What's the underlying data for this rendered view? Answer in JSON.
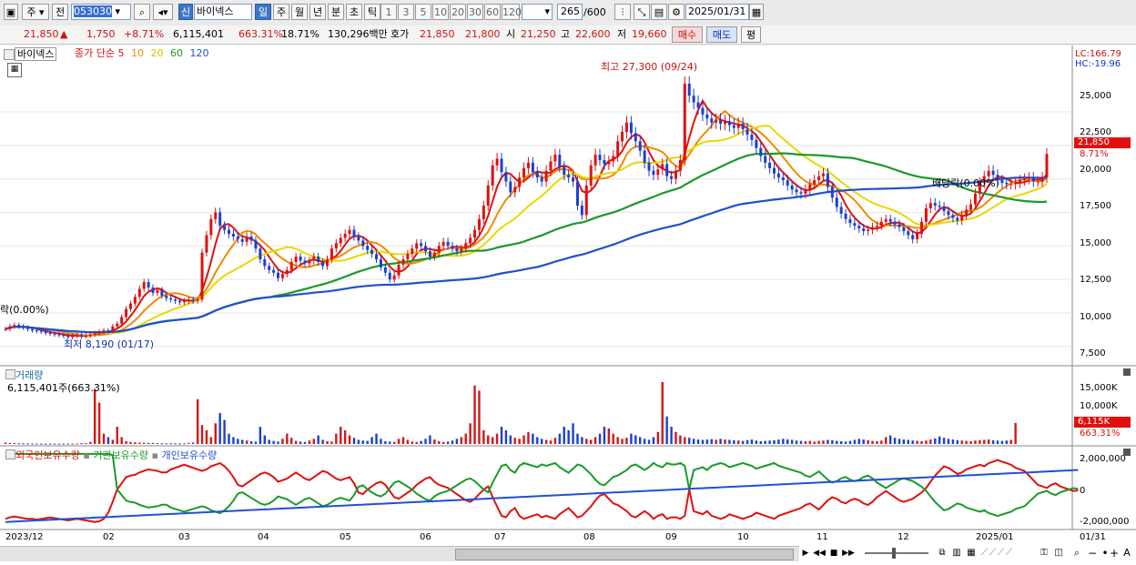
{
  "toolbar": {
    "type_label": "주",
    "prev_label": "전",
    "code": "053030",
    "stock_name": "바이넥스",
    "stock_tag": "신",
    "period_tabs": [
      "일",
      "주",
      "월",
      "년",
      "분",
      "초",
      "틱"
    ],
    "interval_buttons": [
      "1",
      "3",
      "5",
      "10",
      "20",
      "30",
      "60",
      "120"
    ],
    "count_current": "265",
    "count_total": "/600",
    "date": "2025/01/31"
  },
  "quote": {
    "price": "21,850",
    "change": "1,750",
    "change_pct": "+8.71%",
    "volume": "6,115,401",
    "volume_ratio": "663.31%",
    "turnover": "18.71%",
    "amount": "130,296백만",
    "bid_label": "호가",
    "ask_price": "21,850",
    "bid_price": "21,800",
    "open_label": "시",
    "open": "21,250",
    "high_label": "고",
    "high": "22,600",
    "low_label": "저",
    "low": "19,660",
    "buy_button": "매수",
    "sell_button": "매도",
    "eval_button": "평"
  },
  "price_panel": {
    "name_tag": "바이넥스",
    "ma_label": "종가 단순",
    "ma_periods": [
      "5",
      "10",
      "20",
      "60",
      "120"
    ],
    "ma_colors": [
      "#e01010",
      "#f08a00",
      "#e8d800",
      "#1a9a2a",
      "#2050d0"
    ],
    "lc": "LC:166.79",
    "hc": "HC:-19.96",
    "high_annotation": "최고 27,300 (09/24)",
    "low_annotation": "최저 8,190 (01/17)",
    "left_annotation": "락(0.00%)",
    "dividend_annotation": "배당락(0.00%)",
    "current_price_tag": "21,850",
    "current_pct_tag": "8.71%",
    "y_ticks": [
      "25,000",
      "22,500",
      "20,000",
      "17,500",
      "15,000",
      "12,500",
      "10,000",
      "7,500"
    ]
  },
  "volume_panel": {
    "title": "거래량",
    "value_label": "6,115,401주(663.31%)",
    "y_ticks": [
      "15,000K",
      "10,000K"
    ],
    "current_tag": "6,115K",
    "current_pct": "663.31%"
  },
  "holdings_panel": {
    "legend": [
      "외국인보유수량",
      "기관보유수량",
      "개인보유수량"
    ],
    "legend_colors": [
      "#e01010",
      "#1a9a2a",
      "#2050d0"
    ],
    "y_ticks": [
      "2,000,000",
      "0",
      "-2,000,000"
    ]
  },
  "x_axis": [
    "2023/12",
    "02",
    "03",
    "04",
    "05",
    "06",
    "07",
    "08",
    "09",
    "10",
    "11",
    "12",
    "2025/01",
    "01/31"
  ],
  "chart_data": {
    "type": "line",
    "ylim": [
      6200,
      29400
    ],
    "y_ticks": [
      25000,
      22500,
      20000,
      17500,
      15000,
      12500,
      10000,
      7500
    ],
    "close": [
      8800,
      9000,
      9100,
      9000,
      8900,
      8800,
      8700,
      8650,
      8600,
      8500,
      8450,
      8400,
      8350,
      8300,
      8200,
      8300,
      8350,
      8250,
      8300,
      8400,
      8500,
      8600,
      8700,
      8650,
      9000,
      9200,
      9700,
      10300,
      10700,
      11200,
      11800,
      12300,
      11900,
      11500,
      11700,
      11300,
      11100,
      11000,
      10900,
      10800,
      10900,
      11000,
      10900,
      11000,
      14500,
      15800,
      17000,
      17500,
      16500,
      16200,
      15900,
      15700,
      15500,
      15300,
      15700,
      15400,
      14800,
      14000,
      13500,
      13200,
      13000,
      12600,
      12900,
      13200,
      13800,
      14200,
      13900,
      13700,
      13900,
      14200,
      13800,
      13500,
      14000,
      14800,
      15200,
      15600,
      15900,
      16200,
      15700,
      15400,
      15000,
      14700,
      14400,
      14000,
      13400,
      13000,
      12500,
      12800,
      13600,
      14000,
      14400,
      14800,
      15200,
      15000,
      14600,
      14200,
      14500,
      15000,
      15300,
      15000,
      14800,
      14600,
      14800,
      15200,
      15600,
      16200,
      17000,
      18000,
      19500,
      21000,
      21500,
      20500,
      19800,
      19000,
      19400,
      20100,
      20800,
      21200,
      20500,
      20100,
      19800,
      20600,
      21300,
      21800,
      20900,
      20300,
      20100,
      19800,
      18000,
      17300,
      19500,
      21000,
      21800,
      21400,
      21100,
      21300,
      21700,
      22800,
      23500,
      24200,
      23400,
      22800,
      22100,
      21200,
      20600,
      20300,
      20700,
      21100,
      20200,
      20000,
      20600,
      21400,
      27100,
      26200,
      25700,
      25300,
      24800,
      24500,
      24200,
      24400,
      24100,
      24300,
      24000,
      23800,
      24100,
      23700,
      23300,
      22900,
      22300,
      21700,
      21200,
      20800,
      20400,
      20100,
      19900,
      19500,
      19200,
      19000,
      18900,
      19200,
      19600,
      19900,
      20200,
      20400,
      19400,
      18600,
      17900,
      17400,
      17000,
      16700,
      16500,
      16300,
      16100,
      16200,
      16400,
      16500,
      16800,
      17000,
      16800,
      16600,
      16400,
      16100,
      15800,
      15500,
      15900,
      16800,
      17800,
      18200,
      18000,
      17900,
      17600,
      17300,
      17100,
      16900,
      17300,
      17700,
      18100,
      18900,
      19700,
      20200,
      20600,
      20300,
      19900,
      19700,
      19600,
      19600,
      19700,
      19900,
      20000,
      20100,
      19800,
      19800,
      20100,
      21850
    ],
    "volume_k": [
      400,
      300,
      250,
      200,
      180,
      150,
      120,
      100,
      100,
      80,
      90,
      110,
      100,
      90,
      120,
      100,
      150,
      200,
      250,
      600,
      16000,
      12000,
      3000,
      2000,
      1200,
      5000,
      2000,
      800,
      600,
      500,
      400,
      350,
      300,
      300,
      250,
      200,
      200,
      200,
      150,
      150,
      200,
      300,
      400,
      13000,
      5500,
      4000,
      2000,
      6000,
      9000,
      7000,
      3000,
      2000,
      1500,
      1200,
      1000,
      800,
      700,
      5000,
      2500,
      1200,
      900,
      700,
      1500,
      3000,
      1800,
      900,
      700,
      600,
      1000,
      1500,
      2500,
      1200,
      800,
      700,
      3000,
      5000,
      4000,
      2500,
      1800,
      1200,
      1000,
      900,
      2000,
      3000,
      1500,
      800,
      700,
      600,
      1500,
      2000,
      1200,
      700,
      600,
      900,
      1500,
      2500,
      1300,
      800,
      600,
      700,
      1000,
      1500,
      2000,
      3000,
      6000,
      17000,
      15500,
      4000,
      2500,
      2000,
      3000,
      5000,
      4000,
      2500,
      1800,
      1500,
      2500,
      3500,
      3000,
      2000,
      1500,
      1200,
      1000,
      1800,
      3000,
      5000,
      4000,
      6000,
      3000,
      2000,
      1500,
      1200,
      2000,
      3000,
      5000,
      4500,
      3000,
      2000,
      1500,
      1800,
      3000,
      2500,
      2000,
      1500,
      1200,
      2000,
      3500,
      18000,
      8000,
      5000,
      3500,
      2500,
      2000,
      1800,
      1500,
      1300,
      1200,
      1300,
      1400,
      1200,
      1500,
      1300,
      1200,
      1100,
      1000,
      900,
      1100,
      1300,
      1000,
      800,
      900,
      1000,
      1100,
      1300,
      1500,
      1300,
      1200,
      1000,
      900,
      800,
      900,
      700,
      900,
      1000,
      1200,
      1100,
      900,
      800,
      700,
      900,
      1200,
      1500,
      1300,
      1100,
      900,
      800,
      1000,
      2000,
      2500,
      1800,
      1500,
      1300,
      1200,
      1000,
      900,
      800,
      1000,
      1300,
      1600,
      2200,
      1800,
      1500,
      1300,
      1100,
      1000,
      900,
      800,
      1000,
      1100,
      1200,
      1300,
      1100,
      1000,
      900,
      1000,
      1200,
      6115
    ],
    "foreign_k": [
      -1900,
      -1800,
      -1750,
      -1800,
      -1850,
      -1900,
      -1900,
      -1950,
      -1900,
      -1850,
      -1800,
      -1850,
      -1900,
      -1950,
      -2000,
      -1950,
      -1900,
      -1950,
      -2000,
      -2050,
      -2100,
      -2050,
      -1900,
      -1500,
      -800,
      0,
      400,
      800,
      900,
      950,
      1100,
      1200,
      1300,
      1250,
      1200,
      1100,
      1100,
      1300,
      1400,
      1500,
      1600,
      1500,
      1400,
      1300,
      1200,
      1300,
      1500,
      1600,
      1700,
      1500,
      1200,
      800,
      300,
      200,
      400,
      600,
      800,
      1000,
      1100,
      1000,
      800,
      500,
      600,
      700,
      900,
      1100,
      900,
      700,
      600,
      800,
      1000,
      1200,
      1100,
      900,
      700,
      600,
      700,
      800,
      400,
      -200,
      -300,
      0,
      200,
      400,
      500,
      300,
      -100,
      -500,
      -600,
      -400,
      -200,
      0,
      300,
      500,
      700,
      800,
      500,
      300,
      200,
      100,
      -100,
      -300,
      -500,
      -700,
      -800,
      -600,
      -300,
      0,
      200,
      -500,
      -1100,
      -1700,
      -1800,
      -1400,
      -1200,
      -1700,
      -1900,
      -1800,
      -1700,
      -1600,
      -1800,
      -1700,
      -1800,
      -1900,
      -1600,
      -1400,
      -1200,
      -1500,
      -1800,
      -1700,
      -1400,
      -1100,
      -700,
      -400,
      -300,
      -600,
      -900,
      -1000,
      -1200,
      -1400,
      -1700,
      -1800,
      -1600,
      -1400,
      -1600,
      -1900,
      -1700,
      -1600,
      -1900,
      -1800,
      -1800,
      -1900,
      -1700,
      0,
      -1400,
      -1500,
      -1600,
      -1400,
      -1700,
      -1800,
      -1900,
      -1800,
      -1600,
      -1700,
      -1800,
      -1900,
      -1800,
      -1700,
      -1500,
      -1600,
      -1700,
      -1800,
      -1900,
      -1700,
      -1600,
      -1500,
      -1400,
      -1300,
      -1200,
      -1000,
      -900,
      -1100,
      -1300,
      -1000,
      -700,
      -500,
      -600,
      -800,
      -900,
      -700,
      -600,
      -700,
      -900,
      -1000,
      -800,
      -500,
      -300,
      -100,
      -300,
      -500,
      -700,
      -800,
      -700,
      -600,
      -400,
      -200,
      100,
      500,
      900,
      1200,
      1500,
      1400,
      1200,
      1000,
      1100,
      1300,
      1400,
      1500,
      1600,
      1500,
      1700,
      1800,
      1900,
      1800,
      1700,
      1600,
      1400,
      1300,
      1200,
      900,
      600,
      300,
      200,
      100,
      300,
      400,
      200,
      100,
      0,
      -100,
      -50
    ]
  }
}
